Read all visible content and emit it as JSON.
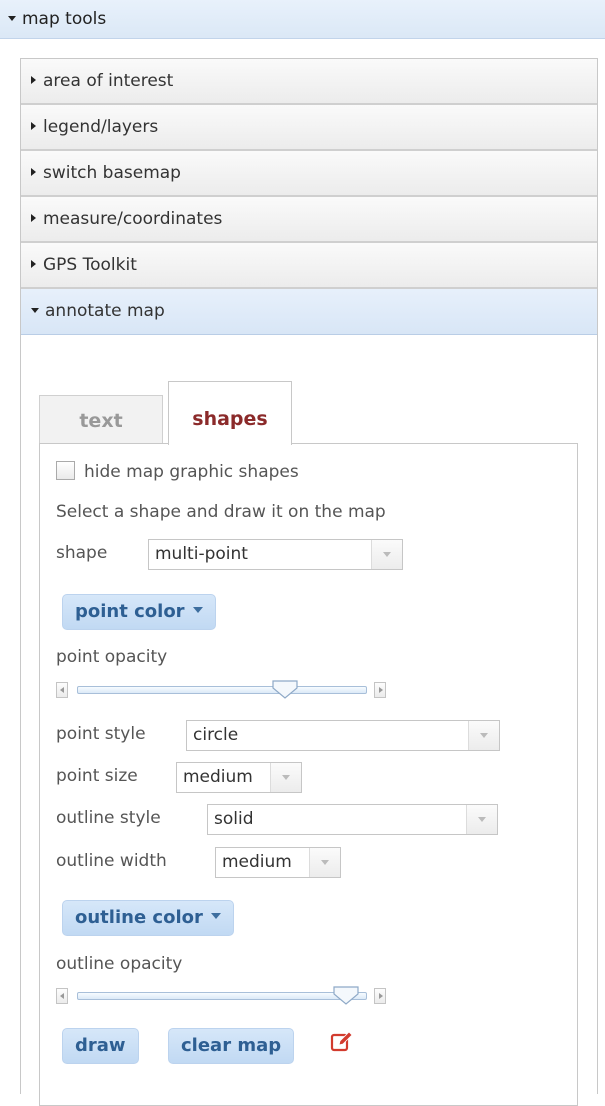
{
  "header": {
    "title": "map tools"
  },
  "accordion": {
    "items": [
      {
        "label": "area of interest"
      },
      {
        "label": "legend/layers"
      },
      {
        "label": "switch basemap"
      },
      {
        "label": "measure/coordinates"
      },
      {
        "label": "GPS Toolkit"
      },
      {
        "label": "annotate map"
      }
    ]
  },
  "tabs": {
    "text": "text",
    "shapes": "shapes",
    "active": "shapes"
  },
  "shapes": {
    "hide_label": "hide map graphic shapes",
    "hide_checked": false,
    "instruction": "Select a shape and draw it on the map",
    "shape_label": "shape",
    "shape_value": "multi-point",
    "point_color_label": "point color",
    "point_opacity_label": "point opacity",
    "point_opacity_value": 0.75,
    "point_style_label": "point style",
    "point_style_value": "circle",
    "point_size_label": "point size",
    "point_size_value": "medium",
    "outline_style_label": "outline style",
    "outline_style_value": "solid",
    "outline_width_label": "outline width",
    "outline_width_value": "medium",
    "outline_color_label": "outline color",
    "outline_opacity_label": "outline opacity",
    "outline_opacity_value": 0.95,
    "draw_label": "draw",
    "clear_label": "clear map"
  },
  "colors": {
    "accent": "#2e5f93",
    "active_tab": "#8b2a2a",
    "edit_icon": "#d23b2e"
  },
  "icons": [
    "chevron-down-icon",
    "chevron-right-icon",
    "edit-icon"
  ]
}
